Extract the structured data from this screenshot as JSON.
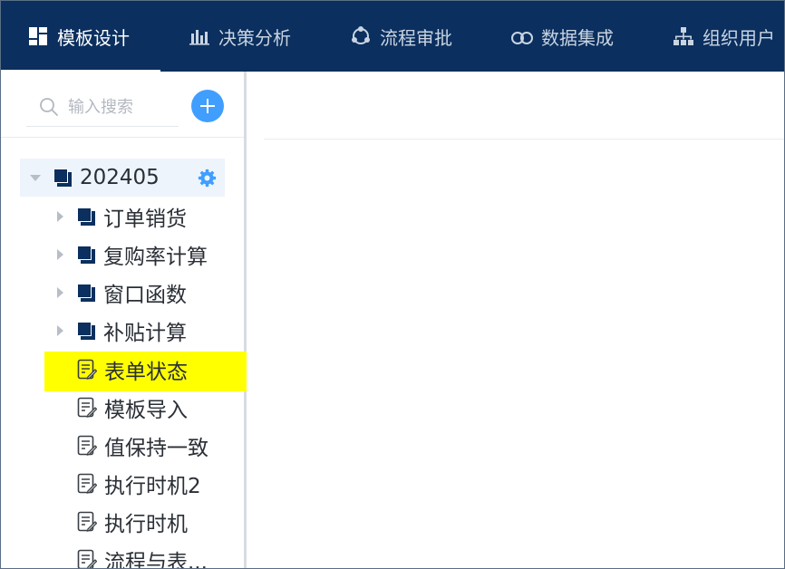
{
  "nav": {
    "items": [
      {
        "label": "模板设计",
        "icon": "grid-icon",
        "active": true
      },
      {
        "label": "决策分析",
        "icon": "bar-chart-icon",
        "active": false
      },
      {
        "label": "流程审批",
        "icon": "cycle-icon",
        "active": false
      },
      {
        "label": "数据集成",
        "icon": "cloud-link-icon",
        "active": false
      },
      {
        "label": "组织用户",
        "icon": "org-chart-icon",
        "active": false
      }
    ]
  },
  "sidebar": {
    "search": {
      "placeholder": "输入搜索",
      "value": ""
    },
    "tree": {
      "root": {
        "label": "202405",
        "icon": "folder-icon",
        "expanded": true
      },
      "children": [
        {
          "label": "订单销货",
          "icon": "folder-icon",
          "type": "folder"
        },
        {
          "label": "复购率计算",
          "icon": "folder-icon",
          "type": "folder"
        },
        {
          "label": "窗口函数",
          "icon": "folder-icon",
          "type": "folder"
        },
        {
          "label": "补贴计算",
          "icon": "folder-icon",
          "type": "folder"
        },
        {
          "label": "表单状态",
          "icon": "document-edit-icon",
          "type": "file",
          "highlighted": true
        },
        {
          "label": "模板导入",
          "icon": "document-edit-icon",
          "type": "file"
        },
        {
          "label": "值保持一致",
          "icon": "document-edit-icon",
          "type": "file"
        },
        {
          "label": "执行时机2",
          "icon": "document-edit-icon",
          "type": "file"
        },
        {
          "label": "执行时机",
          "icon": "document-edit-icon",
          "type": "file"
        },
        {
          "label": "流程与表...",
          "icon": "document-edit-icon",
          "type": "file"
        }
      ]
    }
  },
  "colors": {
    "nav_bg": "#0b2f5e",
    "accent": "#409eff",
    "folder": "#0b2f5e",
    "highlight": "#ffff00",
    "root_bg": "#eef4fb"
  }
}
